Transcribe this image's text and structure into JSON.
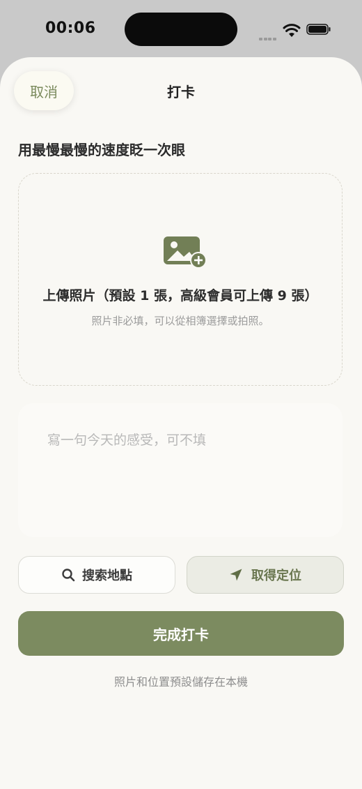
{
  "status_bar": {
    "time": "00:06"
  },
  "header": {
    "cancel_label": "取消",
    "title": "打卡"
  },
  "prompt": "用最慢最慢的速度眨一次眼",
  "upload": {
    "icon": "image-add-icon",
    "label": "上傳照片（預設 1 張，高級會員可上傳 9 張）",
    "hint": "照片非必填，可以從相簿選擇或拍照。"
  },
  "note": {
    "value": "",
    "placeholder": "寫一句今天的感受，可不填"
  },
  "actions": {
    "search_label": "搜索地點",
    "search_icon": "search-icon",
    "locate_label": "取得定位",
    "locate_icon": "location-arrow-icon"
  },
  "submit_label": "完成打卡",
  "footer_note": "照片和位置預設儲存在本機",
  "colors": {
    "accent": "#7c8b60",
    "background": "#f9f8f4"
  }
}
